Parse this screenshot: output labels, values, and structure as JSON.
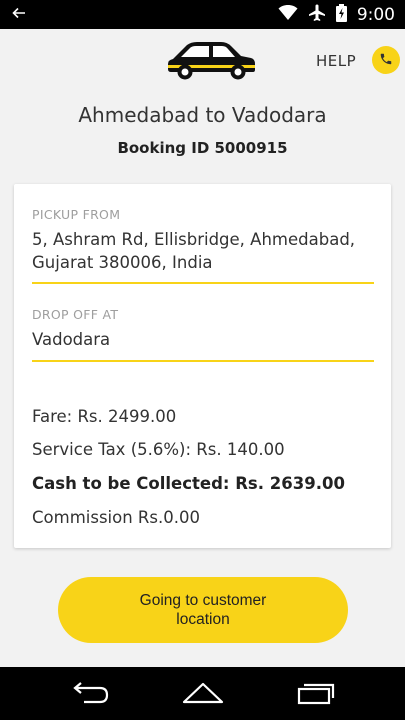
{
  "status_bar": {
    "time": "9:00",
    "icons": [
      "back-arrow-icon",
      "wifi-icon",
      "airplane-icon",
      "battery-icon"
    ]
  },
  "header": {
    "logo_icon": "car-icon",
    "help_label": "HELP",
    "help_icon": "phone-icon"
  },
  "trip": {
    "route_title": "Ahmedabad to Vadodara",
    "booking_id": "Booking ID 5000915"
  },
  "pickup": {
    "label": "PICKUP FROM",
    "address_line1": "5, Ashram Rd, Ellisbridge, Ahmedabad,",
    "address_line2": "Gujarat 380006, India"
  },
  "dropoff": {
    "label": "DROP OFF AT",
    "address": "Vadodara"
  },
  "fare": {
    "fare_text": "Fare: Rs. 2499.00",
    "service_tax_text": "Service Tax (5.6%): Rs. 140.00",
    "cash_text": "Cash to be Collected: Rs. 2639.00",
    "commission_text": "Commission Rs.0.00"
  },
  "action": {
    "label": "Going to customer location"
  },
  "nav_bar": {
    "icons": [
      "back-icon",
      "home-icon",
      "recents-icon"
    ]
  },
  "colors": {
    "accent": "#f8d318",
    "background": "#f2f2f2",
    "card": "#ffffff",
    "status_bar": "#000000"
  }
}
